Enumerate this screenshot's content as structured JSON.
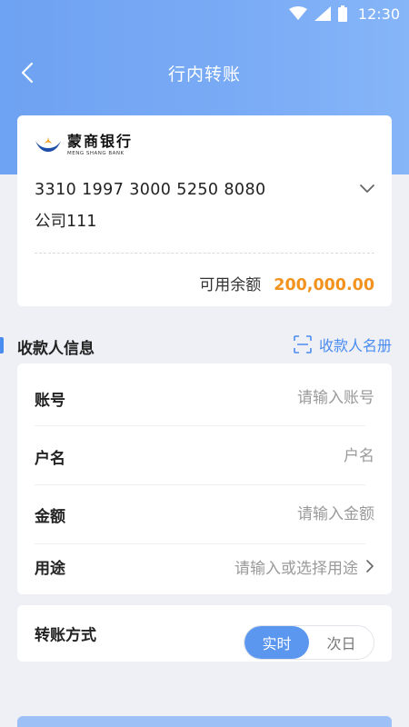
{
  "status_bar": {
    "time": "12:30",
    "icons": [
      "wifi-icon",
      "signal-icon",
      "battery-icon"
    ]
  },
  "nav": {
    "title": "行内转账",
    "back_icon": "chevron-left-icon"
  },
  "account": {
    "bank_name_cn": "蒙商银行",
    "bank_name_en": "MENG SHANG BANK",
    "number": "3310 1997 3000 5250 8080",
    "name": "公司111",
    "balance_label": "可用余额",
    "balance_value": "200,000.00"
  },
  "payee_section": {
    "title": "收款人信息",
    "book_label": "收款人名册",
    "book_icon": "scan-icon"
  },
  "form": {
    "account": {
      "label": "账号",
      "placeholder": "请输入账号",
      "value": ""
    },
    "name": {
      "label": "户名",
      "placeholder": "户名",
      "value": ""
    },
    "amount": {
      "label": "金额",
      "placeholder": "请输入金额",
      "value": ""
    },
    "purpose": {
      "label": "用途",
      "placeholder": "请输入或选择用途"
    }
  },
  "transfer_method": {
    "label": "转账方式",
    "options": [
      "实时",
      "次日"
    ],
    "selected": "实时"
  },
  "colors": {
    "header": "#74a7f4",
    "accent": "#4a8cf0",
    "balance": "#f2931f",
    "background": "#eef0f5"
  }
}
